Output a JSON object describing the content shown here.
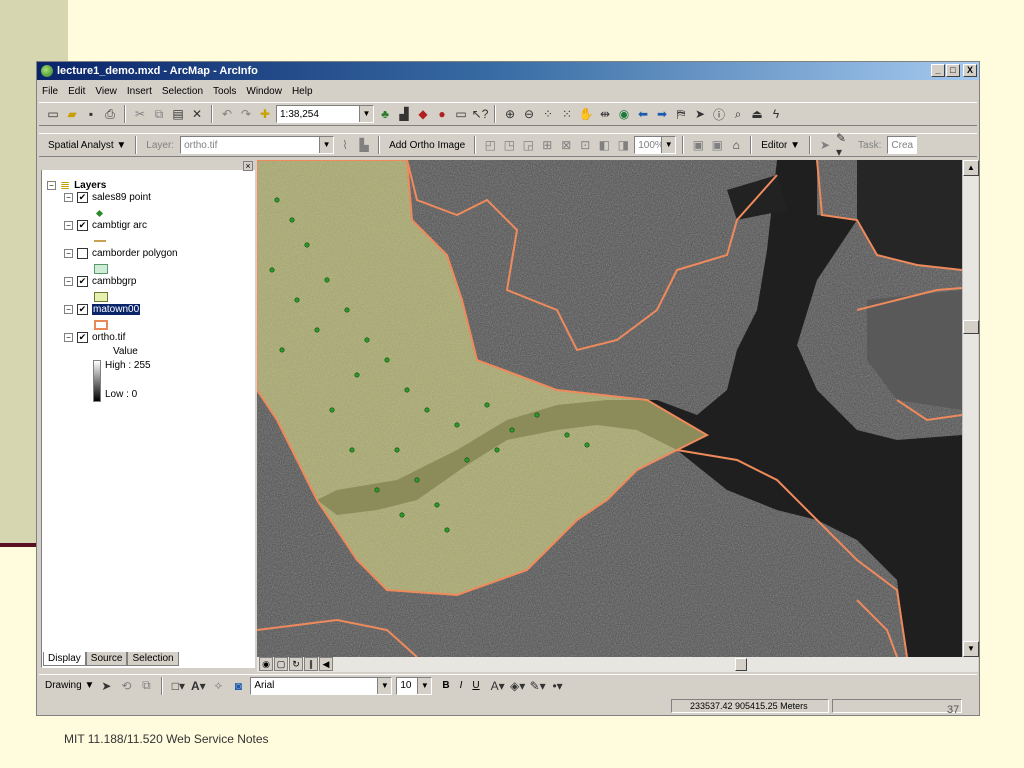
{
  "window": {
    "title": "lecture1_demo.mxd - ArcMap - ArcInfo",
    "controls": [
      "_",
      "□",
      "X"
    ]
  },
  "menu": [
    "File",
    "Edit",
    "View",
    "Insert",
    "Selection",
    "Tools",
    "Window",
    "Help"
  ],
  "toolbar": {
    "scale": "1:38,254"
  },
  "toolbar2": {
    "spatial_analyst": "Spatial Analyst ▼",
    "layer_label": "Layer:",
    "layer_value": "ortho.tif",
    "add_ortho": "Add Ortho Image",
    "zoom_pct": "100%",
    "editor": "Editor ▼",
    "task_label": "Task:",
    "task_value": "Crea"
  },
  "toc": {
    "root": "Layers",
    "layers": [
      {
        "name": "sales89 point",
        "checked": true,
        "selected": false
      },
      {
        "name": "cambtigr arc",
        "checked": true,
        "selected": false
      },
      {
        "name": "camborder polygon",
        "checked": false,
        "selected": false
      },
      {
        "name": "cambbgrp",
        "checked": true,
        "selected": false
      },
      {
        "name": "matown00",
        "checked": true,
        "selected": true
      },
      {
        "name": "ortho.tif",
        "checked": true,
        "selected": false
      }
    ],
    "legend": {
      "value": "Value",
      "high": "High : 255",
      "low": "Low : 0"
    },
    "tabs": [
      "Display",
      "Source",
      "Selection"
    ]
  },
  "drawing": {
    "drawing_label": "Drawing ▼",
    "font": "Arial",
    "size": "10",
    "bold": "B",
    "italic": "I",
    "underline": "U"
  },
  "status": {
    "coords": "233537.42  905415.25 Meters"
  },
  "slide": {
    "footer": "MIT 11.188/11.520 Web Service Notes",
    "page": "37"
  },
  "colors": {
    "boundary": "#ee8a5c",
    "polygon_fill": "#e5e48a",
    "points": "#2a9a2a"
  }
}
